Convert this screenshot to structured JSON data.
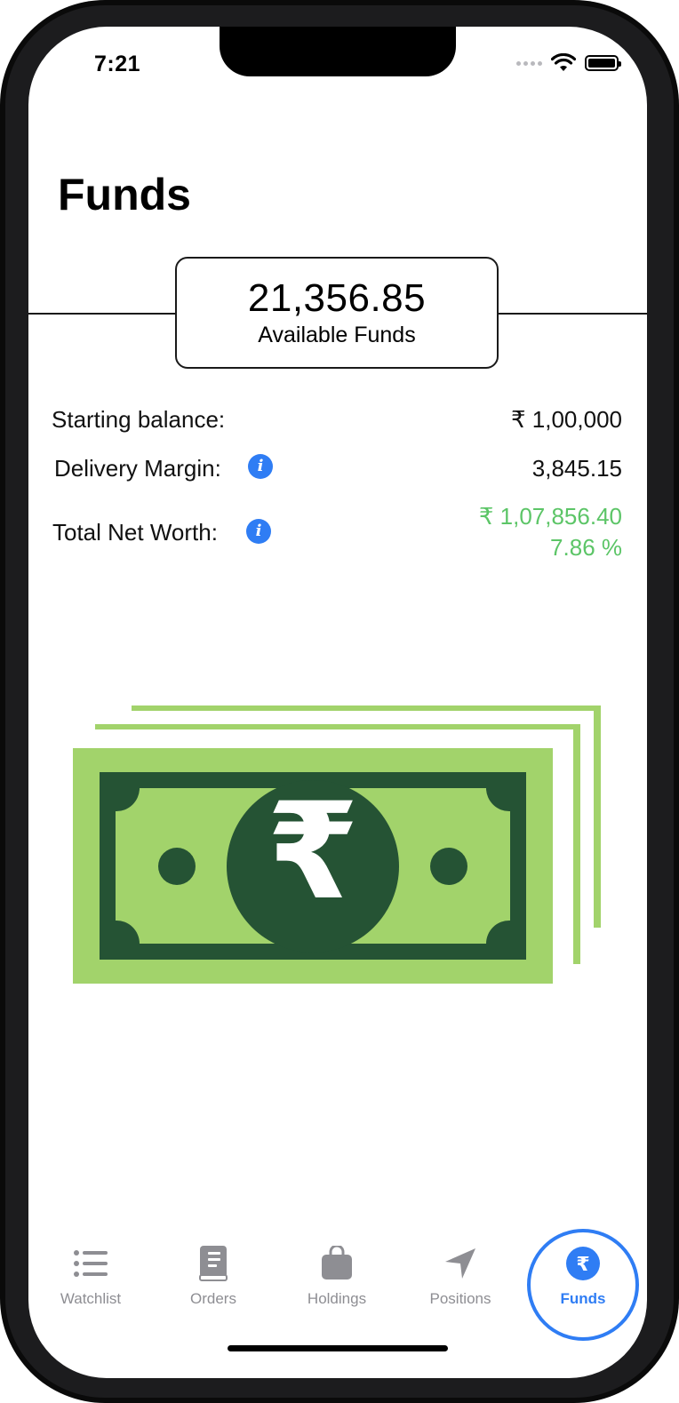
{
  "status_bar": {
    "time": "7:21"
  },
  "page": {
    "title": "Funds"
  },
  "available_funds": {
    "amount": "21,356.85",
    "label": "Available Funds"
  },
  "summary": {
    "starting_balance_label": "Starting balance:",
    "starting_balance_value": "₹ 1,00,000",
    "delivery_margin_label": "Delivery Margin:",
    "delivery_margin_value": "3,845.15",
    "net_worth_label": "Total Net Worth:",
    "net_worth_value": "₹ 1,07,856.40",
    "net_worth_change": "7.86 %",
    "info_icon_glyph": "i"
  },
  "illustration": {
    "currency_symbol": "₹"
  },
  "tabs": [
    {
      "label": "Watchlist",
      "icon": "list-icon",
      "active": false
    },
    {
      "label": "Orders",
      "icon": "book-icon",
      "active": false
    },
    {
      "label": "Holdings",
      "icon": "bag-icon",
      "active": false
    },
    {
      "label": "Positions",
      "icon": "location-arrow-icon",
      "active": false
    },
    {
      "label": "Funds",
      "icon": "rupee-icon",
      "active": true
    }
  ],
  "colors": {
    "accent": "#2f7df4",
    "positive": "#5cc567",
    "note_light": "#a2d36b",
    "note_dark": "#255334",
    "tab_inactive": "#8e8e93"
  }
}
